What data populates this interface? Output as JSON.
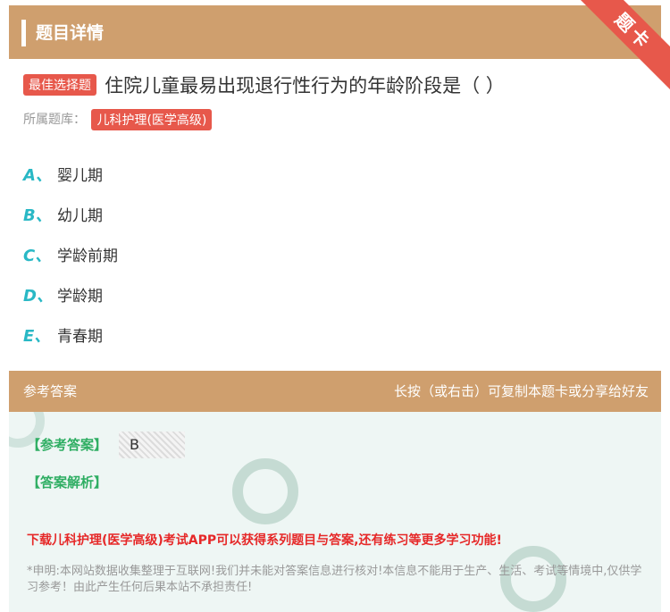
{
  "header": {
    "title": "题目详情",
    "ribbon": "题卡"
  },
  "question": {
    "type_badge": "最佳选择题",
    "text": "住院儿童最易出现退行性行为的年龄阶段是（ ）",
    "bank_label": "所属题库：",
    "bank_name": "儿科护理(医学高级)"
  },
  "options": [
    {
      "letter": "A、",
      "text": "婴儿期"
    },
    {
      "letter": "B、",
      "text": "幼儿期"
    },
    {
      "letter": "C、",
      "text": "学龄前期"
    },
    {
      "letter": "D、",
      "text": "学龄期"
    },
    {
      "letter": "E、",
      "text": "青春期"
    }
  ],
  "answer_section": {
    "title": "参考答案",
    "hint": "长按（或右击）可复制本题卡或分享给好友",
    "answer_label": "【参考答案】",
    "answer_value": "B",
    "analysis_label": "【答案解析】",
    "download_text": "下载儿科护理(医学高级)考试APP可以获得系列题目与答案,还有练习等更多学习功能!",
    "disclaimer": "*申明:本网站数据收集整理于互联网!我们并未能对答案信息进行核对!本信息不能用于生产、生活、考试等情境中,仅供学习参考！由此产生任何后果本站不承担责任!"
  },
  "colors": {
    "header_bg": "#cf9f6e",
    "accent_red": "#e7584b",
    "option_letter": "#29b8c5",
    "answer_green": "#2fae63",
    "download_red": "#e62828"
  }
}
